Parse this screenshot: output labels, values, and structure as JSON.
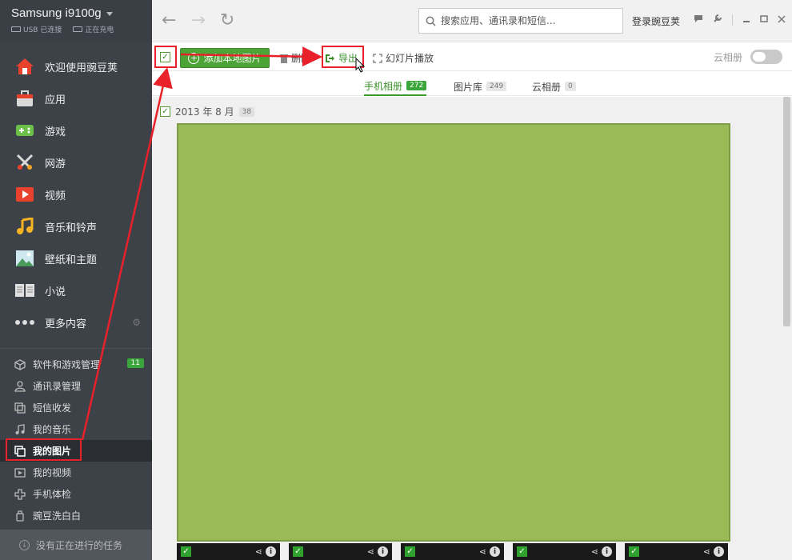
{
  "device": {
    "name": "Samsung i9100g",
    "usb_status": "USB 已连接",
    "charge_status": "正在充电"
  },
  "nav_main": [
    {
      "label": "欢迎使用豌豆荚",
      "icon": "home-icon"
    },
    {
      "label": "应用",
      "icon": "briefcase-icon"
    },
    {
      "label": "游戏",
      "icon": "gamepad-icon"
    },
    {
      "label": "网游",
      "icon": "swords-icon"
    },
    {
      "label": "视频",
      "icon": "play-icon"
    },
    {
      "label": "音乐和铃声",
      "icon": "music-note-icon"
    },
    {
      "label": "壁纸和主题",
      "icon": "landscape-icon"
    },
    {
      "label": "小说",
      "icon": "book-icon"
    },
    {
      "label": "更多内容",
      "icon": "more-dots-icon"
    }
  ],
  "nav_manage": [
    {
      "label": "软件和游戏管理",
      "icon": "cube-icon",
      "badge": "11"
    },
    {
      "label": "通讯录管理",
      "icon": "person-icon"
    },
    {
      "label": "短信收发",
      "icon": "sms-icon"
    },
    {
      "label": "我的音乐",
      "icon": "music-icon"
    },
    {
      "label": "我的图片",
      "icon": "pictures-icon",
      "active": true
    },
    {
      "label": "我的视频",
      "icon": "video-icon"
    },
    {
      "label": "手机体检",
      "icon": "cross-icon"
    },
    {
      "label": "豌豆洗白白",
      "icon": "bottle-icon"
    }
  ],
  "task_status": "没有正在进行的任务",
  "search": {
    "placeholder": "搜索应用、通讯录和短信..."
  },
  "login": "登录豌豆荚",
  "toolbar": {
    "add_label": "添加本地图片",
    "delete_label": "删除",
    "export_label": "导出",
    "slideshow_label": "幻灯片播放",
    "cloud_label": "云相册"
  },
  "tabs": [
    {
      "label": "手机相册",
      "count": "272",
      "active": true
    },
    {
      "label": "图片库",
      "count": "249"
    },
    {
      "label": "云相册",
      "count": "0"
    }
  ],
  "group": {
    "title": "2013 年 8 月",
    "count": "38"
  },
  "colors": {
    "accent": "#3aa53a",
    "highlight": "#e8212b",
    "photo": "#9aba58"
  }
}
